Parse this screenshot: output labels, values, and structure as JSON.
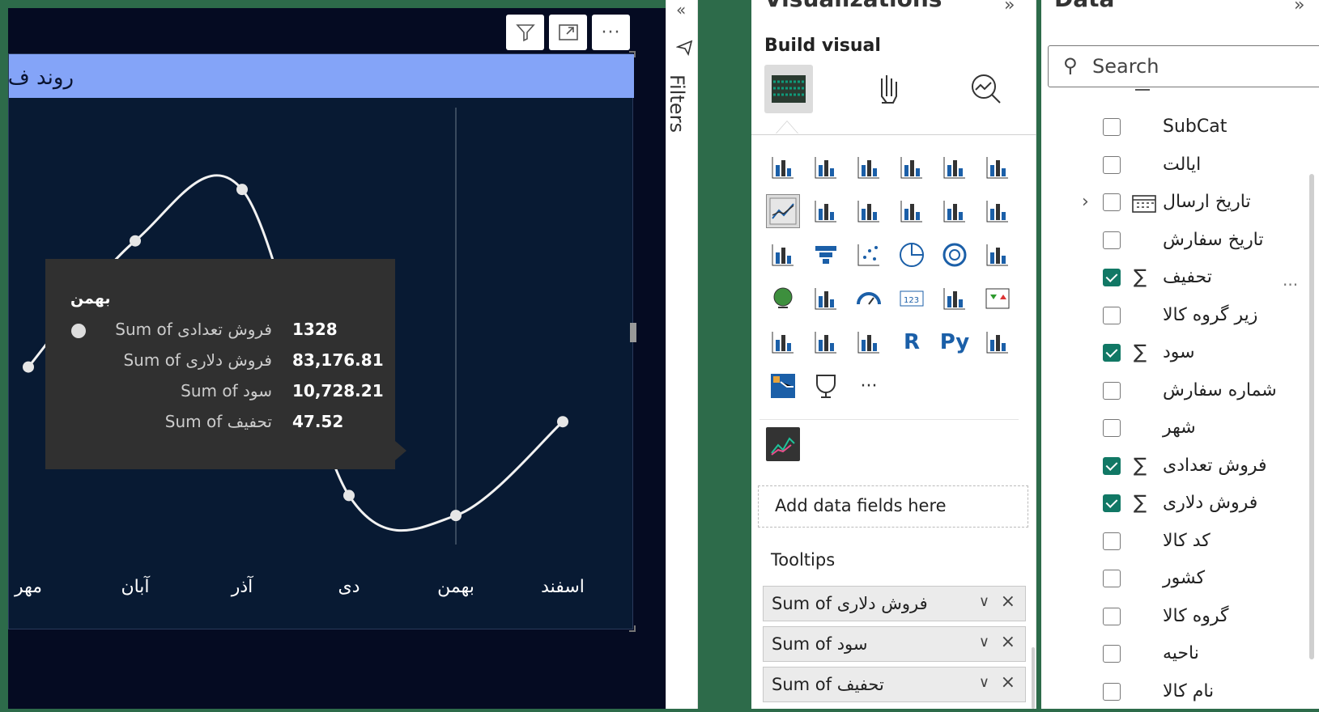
{
  "visual": {
    "title": "روند ف",
    "header_buttons": [
      "filter-icon",
      "focus-mode-icon",
      "more-options-icon"
    ]
  },
  "chart_data": {
    "type": "line",
    "categories": [
      "مهر",
      "آبان",
      "آذر",
      "دی",
      "بهمن",
      "اسفند"
    ],
    "series": [
      {
        "name": "Sum of فروش تعدادی",
        "values": [
          1640,
          1905,
          2013,
          1370,
          1328,
          1525
        ]
      }
    ],
    "title": "روند ف"
  },
  "tooltip": {
    "header": "بهمن",
    "rows": [
      {
        "label": "Sum of فروش تعدادی",
        "value": "1328"
      },
      {
        "label": "Sum of فروش دلاری",
        "value": "83,176.81"
      },
      {
        "label": "Sum of سود",
        "value": "10,728.21"
      },
      {
        "label": "Sum of تحفیف",
        "value": "47.52"
      }
    ]
  },
  "filters": {
    "label": "Filters"
  },
  "visualizations": {
    "header": "Visualizations",
    "build_visual": "Build visual",
    "add_fields": "Add data fields here",
    "tooltips_label": "Tooltips",
    "tooltip_fields": [
      "Sum of فروش دلاری",
      "Sum of سود",
      "Sum of تحفیف"
    ],
    "more": "···",
    "r_label": "R",
    "py_label": "Py"
  },
  "data_pane": {
    "header": "Data",
    "search_placeholder": "Search",
    "fields": [
      {
        "name": "SubCat",
        "checked": false,
        "sigma": false
      },
      {
        "name": "ایالت",
        "checked": false,
        "sigma": false
      },
      {
        "name": "تاریخ ارسال",
        "checked": false,
        "sigma": false,
        "expandable": true,
        "calendar": true
      },
      {
        "name": "تاریخ سفارش",
        "checked": false,
        "sigma": false
      },
      {
        "name": "تحفیف",
        "checked": true,
        "sigma": true
      },
      {
        "name": "زیر گروه کالا",
        "checked": false,
        "sigma": false
      },
      {
        "name": "سود",
        "checked": true,
        "sigma": true
      },
      {
        "name": "شماره سفارش",
        "checked": false,
        "sigma": false
      },
      {
        "name": "شهر",
        "checked": false,
        "sigma": false
      },
      {
        "name": "فروش تعدادی",
        "checked": true,
        "sigma": true
      },
      {
        "name": "فروش دلاری",
        "checked": true,
        "sigma": true
      },
      {
        "name": "کد کالا",
        "checked": false,
        "sigma": false
      },
      {
        "name": "کشور",
        "checked": false,
        "sigma": false
      },
      {
        "name": "گروه کالا",
        "checked": false,
        "sigma": false
      },
      {
        "name": "ناحیه",
        "checked": false,
        "sigma": false
      },
      {
        "name": "نام کالا",
        "checked": false,
        "sigma": false
      }
    ],
    "more_options": "···"
  },
  "colors": {
    "accent": "#117865",
    "title_bar": "#84a4f8",
    "canvas": "#081a33"
  }
}
